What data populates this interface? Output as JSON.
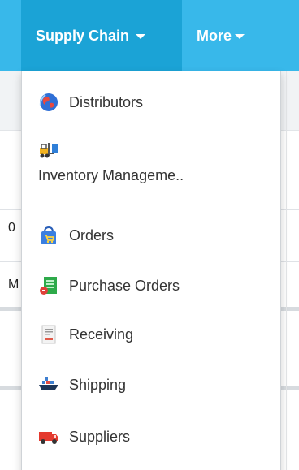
{
  "navbar": {
    "items": [
      {
        "label": "Supply Chain",
        "icon": "caret-down-icon"
      },
      {
        "label": "More",
        "icon": "caret-down-icon"
      }
    ]
  },
  "background": {
    "fragments": [
      "0",
      "M"
    ]
  },
  "dropdown": {
    "items": [
      {
        "label": "Distributors",
        "icon": "globe-icon"
      },
      {
        "label": "Inventory Manageme..",
        "icon": "forklift-icon"
      },
      {
        "label": "Orders",
        "icon": "shopping-bag-icon"
      },
      {
        "label": "Purchase Orders",
        "icon": "document-icon"
      },
      {
        "label": "Receiving",
        "icon": "receipt-icon"
      },
      {
        "label": "Shipping",
        "icon": "ship-icon"
      },
      {
        "label": "Suppliers",
        "icon": "truck-icon"
      }
    ]
  },
  "colors": {
    "navbar": "#38b8ea",
    "navbar_active": "#1ba3d6",
    "menu_text": "#333333"
  }
}
